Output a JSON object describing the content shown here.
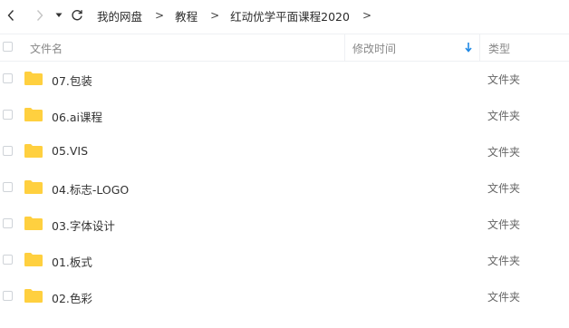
{
  "breadcrumb": {
    "items": [
      "我的网盘",
      "教程",
      "红动优学平面课程2020"
    ],
    "separator": ">"
  },
  "table": {
    "columns": {
      "name": "文件名",
      "modified": "修改时间",
      "type": "类型"
    },
    "sort_icon": "arrow-down-icon",
    "rows": [
      {
        "name": "07.包装",
        "type": "文件夹"
      },
      {
        "name": "06.ai课程",
        "type": "文件夹"
      },
      {
        "name": "05.VIS",
        "type": "文件夹"
      },
      {
        "name": "04.标志-LOGO",
        "type": "文件夹"
      },
      {
        "name": "03.字体设计",
        "type": "文件夹"
      },
      {
        "name": "01.板式",
        "type": "文件夹"
      },
      {
        "name": "02.色彩",
        "type": "文件夹"
      }
    ]
  },
  "colors": {
    "folder": "#ffcf3f",
    "sort_accent": "#1e88e5"
  }
}
